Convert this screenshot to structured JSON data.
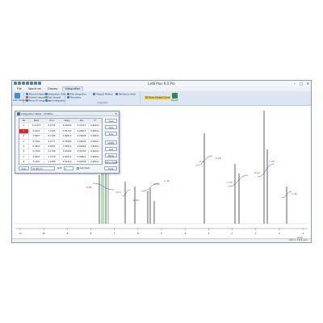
{
  "window": {
    "title": "Let8 Plus 8.0 Pro",
    "controls": {
      "minimize": "–",
      "maximize": "□",
      "close": "✕"
    }
  },
  "ribbon": {
    "tabs": [
      "File",
      "Spectrum",
      "Display",
      "Integration"
    ],
    "active_tab": 3,
    "buttons": [
      "Auto Integration",
      "Manual Integration",
      "Delete Integration",
      "Show All Integration",
      "Integration Table",
      "Set Integral",
      "Split Integration",
      "Edit Integration",
      "Normalize",
      "Integral Method",
      "Reference Value",
      "Show Integral Curve",
      "Export"
    ],
    "group_label": "Integration"
  },
  "dialog": {
    "title": "Integration Table - ShiftPro",
    "close": "✕",
    "columns": [
      "No",
      "Start",
      "End",
      "Integ.",
      "Abs",
      "H"
    ],
    "rows": [
      [
        "1",
        "11.2215",
        "9.4732",
        "2.00000",
        "0.01217",
        "0.98011"
      ],
      [
        "2",
        "9.0321",
        "7.3145",
        "0.84750",
        "0.00614",
        "0.98011"
      ],
      [
        "3",
        "7.8927",
        "6.7145",
        "1.82910",
        "0.00694",
        "0.98011"
      ],
      [
        "4",
        "6.7002",
        "6.2777",
        "0.23480",
        "0.00006",
        "0.98011"
      ],
      [
        "5",
        "6.0823",
        "5.8381",
        "1.90510",
        "0.00686",
        "0.98011"
      ],
      [
        "6",
        "5.7500",
        "5.1709",
        "1.93260",
        "0.00700",
        "0.98011"
      ],
      [
        "7",
        "4.6923",
        "3.3779",
        "2.81010",
        "0.00822",
        "0.98011"
      ],
      [
        "8",
        "3.1847",
        "1.7488",
        "0.82310",
        "0.00296",
        "0.98011"
      ],
      [
        "9",
        "1.6222",
        "0.6410",
        "1.20500",
        "0.00437",
        "0.98011"
      ],
      [
        "10",
        "0.4821",
        "0.1230",
        "0.29140",
        "0.00103",
        "0.98011"
      ]
    ],
    "side_buttons": [
      "Load",
      "Save",
      "Print",
      "Delete",
      "Sort",
      "Merge",
      "Renormalize"
    ],
    "footer": {
      "copy_button": "Copy",
      "name_value": "Int-001.txt",
      "shift_label": "Shift",
      "shift_value": "1",
      "auto_label": "Auto Redo",
      "close_button": "Close"
    }
  },
  "spectrum": {
    "axis_ticks": [
      "11",
      "10",
      "9",
      "8",
      "7",
      "6",
      "5",
      "4",
      "3",
      "2",
      "1",
      "0",
      "-1"
    ],
    "axis_unit": "ppm",
    "integral_labels": [
      "3.50",
      "1.13",
      "2.00",
      "1.00",
      "1.44",
      "2.02",
      "0.98",
      "1.37",
      "3.04",
      "1.25",
      "1.46"
    ],
    "colors": {
      "spectrum": "#1a1a1a",
      "highlight": "#2ea02e",
      "integral": "#3050d0",
      "labels": "#c03030"
    }
  },
  "status": {
    "text": "1024 × 1024 ppm"
  }
}
